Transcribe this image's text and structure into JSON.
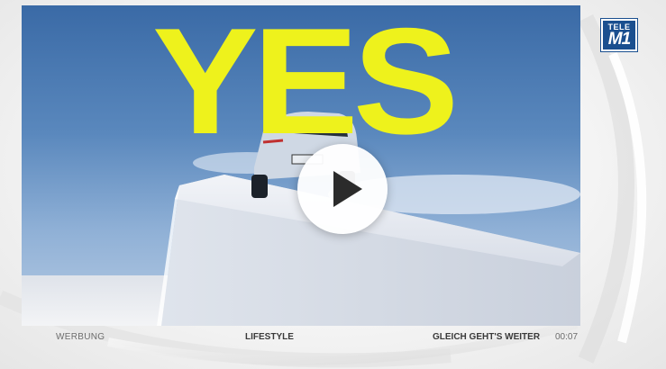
{
  "video": {
    "headline": "YES",
    "play_label": "play-icon"
  },
  "logo": {
    "line1": "TELE",
    "line2": "M1"
  },
  "ticker": {
    "left": "WERBUNG",
    "center": "LIFESTYLE",
    "right": "GLEICH GEHT'S WEITER",
    "time": "00:07"
  },
  "colors": {
    "headline": "#eef21c",
    "sky": "#4a78b0",
    "logo_bg": "#1a4f8f"
  }
}
